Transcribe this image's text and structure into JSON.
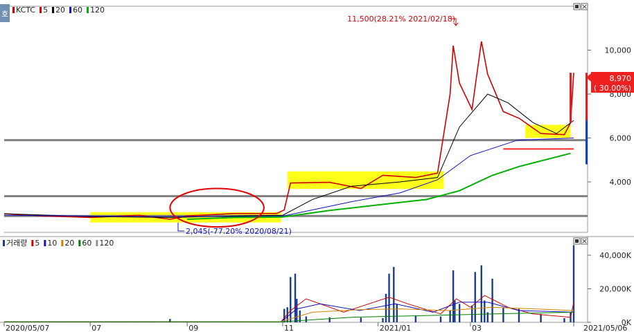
{
  "chart_data": [
    {
      "type": "line",
      "panel": "price",
      "title": "KCTC",
      "legend": [
        {
          "label": "KCTC",
          "color": "#d00000"
        },
        {
          "label": "5",
          "color": "#d00000"
        },
        {
          "label": "20",
          "color": "#000000"
        },
        {
          "label": "60",
          "color": "#1010c0"
        },
        {
          "label": "120",
          "color": "#00b000"
        }
      ],
      "x_start": "2020/05/07",
      "x_end": "2021/05/06",
      "x_ticks": [
        "2020/05/07",
        "07",
        "09",
        "11",
        "2021/01",
        "03",
        "2021/05/06"
      ],
      "x_tick_dates": [
        "2020-05-07",
        "2020-07-01",
        "2020-09-01",
        "2020-11-01",
        "2021-01-01",
        "2021-03-01",
        "2021-05-06"
      ],
      "y_ticks": [
        "10,000",
        "8,000",
        "6,000",
        "4,000"
      ],
      "y_tick_values": [
        10000,
        8000,
        6000,
        4000
      ],
      "ylim": [
        1700,
        12000
      ],
      "grid": false,
      "legend_position": "top-left",
      "max_annotation": "11,500(28.21% 2021/02/18)",
      "min_annotation": "2,045(-77.20% 2020/08/21)",
      "last_price_label": "8,970",
      "last_change_label": "( 30.00%)",
      "series": [
        {
          "name": "5",
          "color": "#d00000",
          "x": [
            "2020-05-07",
            "2020-06-01",
            "2020-07-01",
            "2020-08-01",
            "2020-08-21",
            "2020-09-01",
            "2020-10-01",
            "2020-10-28",
            "2020-11-02",
            "2020-11-06",
            "2020-12-01",
            "2020-12-21",
            "2021-01-04",
            "2021-01-25",
            "2021-02-08",
            "2021-02-16",
            "2021-02-18",
            "2021-02-22",
            "2021-03-02",
            "2021-03-08",
            "2021-03-12",
            "2021-03-22",
            "2021-04-01",
            "2021-04-15",
            "2021-04-30",
            "2021-05-04",
            "2021-05-06"
          ],
          "y": [
            2550,
            2450,
            2380,
            2480,
            2300,
            2450,
            2560,
            2560,
            2720,
            3950,
            3980,
            3700,
            4300,
            4200,
            4400,
            8000,
            10200,
            8500,
            7300,
            10400,
            8900,
            7200,
            6900,
            6200,
            6150,
            6700,
            8970
          ]
        },
        {
          "name": "20",
          "color": "#000000",
          "x": [
            "2020-05-07",
            "2020-07-01",
            "2020-08-21",
            "2020-10-01",
            "2020-11-01",
            "2020-11-20",
            "2020-12-15",
            "2021-01-15",
            "2021-02-08",
            "2021-02-22",
            "2021-03-12",
            "2021-03-25",
            "2021-04-10",
            "2021-04-25",
            "2021-05-06"
          ],
          "y": [
            2550,
            2420,
            2380,
            2450,
            2480,
            3200,
            3800,
            4000,
            4200,
            6500,
            8000,
            7600,
            6700,
            6200,
            6800
          ]
        },
        {
          "name": "60",
          "color": "#1010c0",
          "x": [
            "2020-05-07",
            "2020-08-01",
            "2020-10-01",
            "2020-11-01",
            "2020-12-15",
            "2021-01-15",
            "2021-02-08",
            "2021-03-01",
            "2021-03-31",
            "2021-05-06"
          ],
          "y": [
            2480,
            2420,
            2420,
            2440,
            3100,
            3500,
            4100,
            5200,
            5900,
            6000
          ]
        },
        {
          "name": "120",
          "color": "#00b000",
          "x": [
            "2020-09-01",
            "2020-10-01",
            "2020-11-01",
            "2020-12-01",
            "2021-01-01",
            "2021-02-01",
            "2021-02-22",
            "2021-03-15",
            "2021-04-01",
            "2021-05-04"
          ],
          "y": [
            2300,
            2380,
            2400,
            2700,
            2950,
            3200,
            3600,
            4300,
            4700,
            5300
          ]
        }
      ],
      "horizontal_levels": [
        {
          "y": 5900,
          "color": "#808080"
        },
        {
          "y": 3350,
          "color": "#808080"
        },
        {
          "y": 2450,
          "color": "#808080"
        },
        {
          "y": 5500,
          "color": "#ff2020",
          "x_from": "2021-03-22",
          "x_to": "2021-05-06"
        }
      ],
      "highlight_boxes": [
        {
          "x_from": "2020-07-01",
          "x_to": "2020-10-31",
          "y_low": 2150,
          "y_high": 2620
        },
        {
          "x_from": "2020-11-04",
          "x_to": "2021-02-12",
          "y_low": 3680,
          "y_high": 4480
        },
        {
          "x_from": "2021-04-05",
          "x_to": "2021-05-04",
          "y_low": 6000,
          "y_high": 6600
        }
      ],
      "circle": {
        "x_center": "2020-09-20",
        "y_center": 2620,
        "x_half_days": 30,
        "y_top": 3700,
        "y_bottom": 1950
      }
    },
    {
      "type": "bar",
      "panel": "volume",
      "title": "거래량",
      "legend": [
        {
          "label": "거래량",
          "color": "#1a3c8c"
        },
        {
          "label": "5",
          "color": "#d00000"
        },
        {
          "label": "10",
          "color": "#1010c0"
        },
        {
          "label": "20",
          "color": "#d08000"
        },
        {
          "label": "60",
          "color": "#008000"
        },
        {
          "label": "120",
          "color": "#909090"
        }
      ],
      "y_ticks": [
        "40,000K",
        "20,000K",
        "0K"
      ],
      "y_tick_values": [
        40000,
        20000,
        0
      ],
      "ylim": [
        0,
        47000
      ],
      "unit": "K",
      "x": [
        "2020-05-08",
        "2020-06-10",
        "2020-08-21",
        "2020-11-02",
        "2020-11-04",
        "2020-11-06",
        "2020-11-09",
        "2020-11-10",
        "2020-11-12",
        "2020-11-16",
        "2020-12-01",
        "2020-12-21",
        "2021-01-04",
        "2021-01-06",
        "2021-01-08",
        "2021-01-11",
        "2021-01-13",
        "2021-01-25",
        "2021-02-10",
        "2021-02-16",
        "2021-02-18",
        "2021-02-19",
        "2021-02-22",
        "2021-03-02",
        "2021-03-04",
        "2021-03-08",
        "2021-03-10",
        "2021-03-12",
        "2021-03-15",
        "2021-03-22",
        "2021-04-01",
        "2021-04-15",
        "2021-04-30",
        "2021-05-04",
        "2021-05-06"
      ],
      "values": [
        400,
        500,
        2000,
        8000,
        9000,
        27000,
        29000,
        14000,
        7000,
        3500,
        3000,
        2800,
        2500,
        17000,
        29000,
        33000,
        11000,
        4000,
        3500,
        7000,
        31000,
        13000,
        11000,
        10000,
        30000,
        34000,
        13000,
        6000,
        26000,
        9000,
        8000,
        5000,
        2500,
        6000,
        46000
      ],
      "series": [
        {
          "name": "5",
          "color": "#d00000",
          "x": [
            "2020-05-07",
            "2020-10-31",
            "2020-11-06",
            "2020-11-16",
            "2020-12-10",
            "2021-01-08",
            "2021-01-20",
            "2021-02-10",
            "2021-02-20",
            "2021-03-01",
            "2021-03-10",
            "2021-03-25",
            "2021-04-10",
            "2021-05-04",
            "2021-05-06"
          ],
          "y": [
            300,
            400,
            7000,
            14000,
            6000,
            15000,
            11000,
            5000,
            14000,
            9000,
            16000,
            9000,
            5000,
            3000,
            12000
          ]
        },
        {
          "name": "10",
          "color": "#1010c0",
          "x": [
            "2020-05-07",
            "2020-10-31",
            "2020-11-10",
            "2020-11-25",
            "2020-12-20",
            "2021-01-12",
            "2021-02-05",
            "2021-02-22",
            "2021-03-12",
            "2021-04-01",
            "2021-05-06"
          ],
          "y": [
            300,
            400,
            8000,
            11000,
            7000,
            11000,
            6000,
            12000,
            12000,
            7000,
            6000
          ]
        },
        {
          "name": "20",
          "color": "#d08000",
          "x": [
            "2020-05-07",
            "2020-10-31",
            "2020-11-20",
            "2020-12-20",
            "2021-01-15",
            "2021-02-15",
            "2021-03-15",
            "2021-05-06"
          ],
          "y": [
            300,
            400,
            6000,
            7500,
            8000,
            7000,
            9000,
            7000
          ]
        },
        {
          "name": "60",
          "color": "#008000",
          "x": [
            "2020-05-07",
            "2020-10-31",
            "2020-12-15",
            "2021-01-31",
            "2021-03-15",
            "2021-05-06"
          ],
          "y": [
            300,
            300,
            3000,
            4000,
            5000,
            6000
          ]
        }
      ]
    }
  ],
  "legend_text": {
    "price": [
      "KCTC",
      "5",
      "20",
      "60",
      "120"
    ],
    "volume": [
      "거래량",
      "5",
      "10",
      "20",
      "60",
      "120"
    ]
  },
  "corner_badge": "호"
}
